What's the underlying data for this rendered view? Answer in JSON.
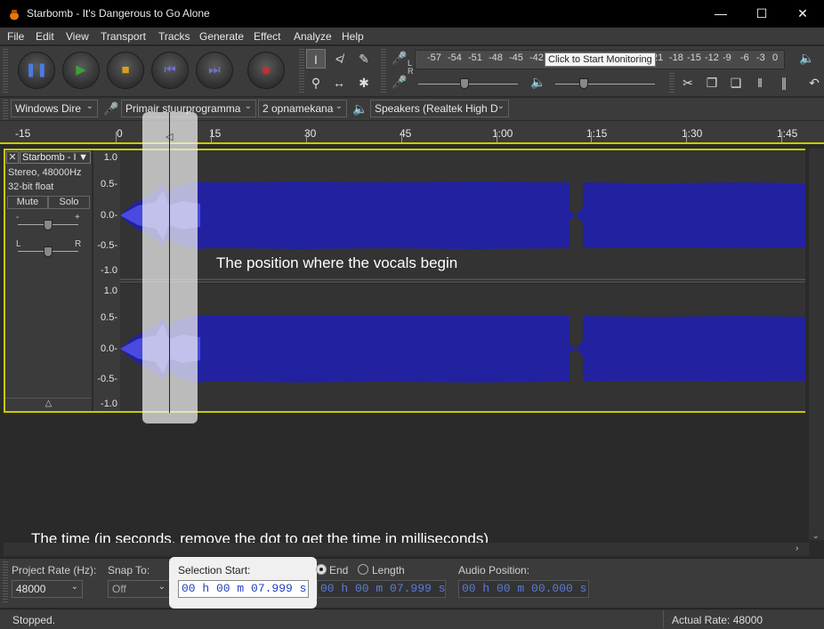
{
  "window": {
    "title": "Starbomb - It's Dangerous to Go Alone",
    "controls": [
      "—",
      "☐",
      "✕"
    ]
  },
  "menu": [
    "File",
    "Edit",
    "View",
    "Transport",
    "Tracks",
    "Generate",
    "Effect",
    "Analyze",
    "Help"
  ],
  "meter": {
    "scale": [
      "-57",
      "-54",
      "-51",
      "-48",
      "-45",
      "-42",
      "-3",
      "21",
      "-18",
      "-15",
      "-12",
      "-9",
      "-6",
      "-3",
      "0"
    ],
    "tooltip": "Click to Start Monitoring",
    "rec_l": "L",
    "rec_r": "R"
  },
  "device": {
    "host": "Windows Dire",
    "input": "Primair stuurprogramma",
    "channels": "2 opnamekana",
    "output": "Speakers (Realtek High D"
  },
  "timeline": [
    "-15",
    "0",
    "15",
    "30",
    "45",
    "1:00",
    "1:15",
    "1:30",
    "1:45"
  ],
  "track": {
    "name": "Starbomb - I",
    "info1": "Stereo, 48000Hz",
    "info2": "32-bit float",
    "mute": "Mute",
    "solo": "Solo",
    "gain_minus": "-",
    "gain_plus": "+",
    "pan_l": "L",
    "pan_r": "R"
  },
  "ruler": [
    "1.0",
    "0.5-",
    "0.0-",
    "-0.5-",
    "-1.0"
  ],
  "annotations": {
    "vocals": "The position where the vocals begin",
    "time": "The time (in seconds, remove the dot to get the time in milliseconds)"
  },
  "selection": {
    "project_rate_label": "Project Rate (Hz):",
    "project_rate": "48000",
    "snap_label": "Snap To:",
    "snap": "Off",
    "start_label": "Selection Start:",
    "start": "00 h 00 m 07.999 s",
    "end_label": "End",
    "length_label": "Length",
    "end": "00 h 00 m 07.999 s",
    "audio_pos_label": "Audio Position:",
    "audio_pos": "00 h 00 m 00.000 s"
  },
  "status": {
    "state": "Stopped.",
    "rate": "Actual Rate: 48000"
  },
  "colors": {
    "waveform": "#2222a0",
    "waveform_peak": "#4a4ae0",
    "selection_border": "#c9c900"
  }
}
